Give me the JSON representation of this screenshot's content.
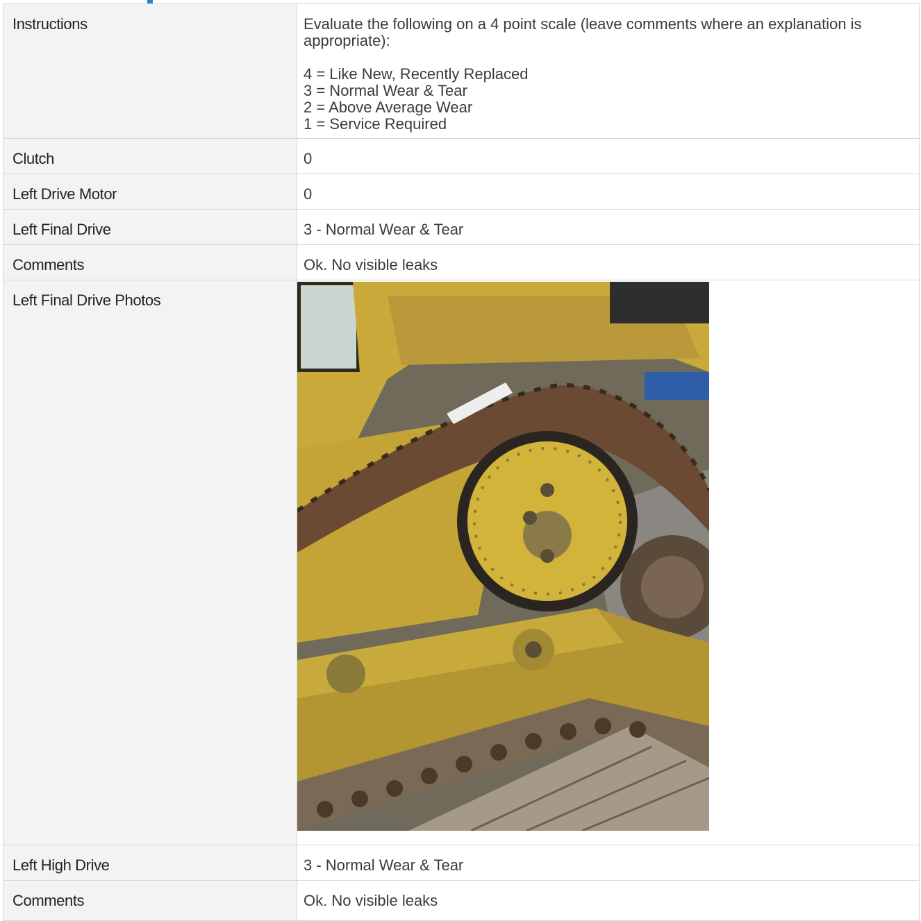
{
  "rows": {
    "instructions": {
      "label": "Instructions",
      "intro": "Evaluate the following on a 4 point scale (leave comments where an explanation is appropriate):",
      "scale": [
        "4 = Like New, Recently Replaced",
        "3 = Normal Wear & Tear",
        "2 = Above Average Wear",
        "1 = Service Required"
      ]
    },
    "clutch": {
      "label": "Clutch",
      "value": "0"
    },
    "left_drive_motor": {
      "label": "Left Drive Motor",
      "value": "0"
    },
    "left_final_drive": {
      "label": "Left Final Drive",
      "value": "3 - Normal Wear & Tear"
    },
    "comments_1": {
      "label": "Comments",
      "value": "Ok.  No visible leaks"
    },
    "left_final_drive_photos": {
      "label": "Left Final Drive Photos",
      "photo_alt": "bulldozer-final-drive-photo"
    },
    "left_high_drive": {
      "label": "Left High Drive",
      "value": "3 - Normal Wear & Tear"
    },
    "comments_2": {
      "label": "Comments",
      "value": "Ok.  No visible leaks"
    }
  },
  "colors": {
    "accent": "#1a8ad8",
    "label_bg": "#f3f3f3",
    "border": "#d6d6d6"
  }
}
